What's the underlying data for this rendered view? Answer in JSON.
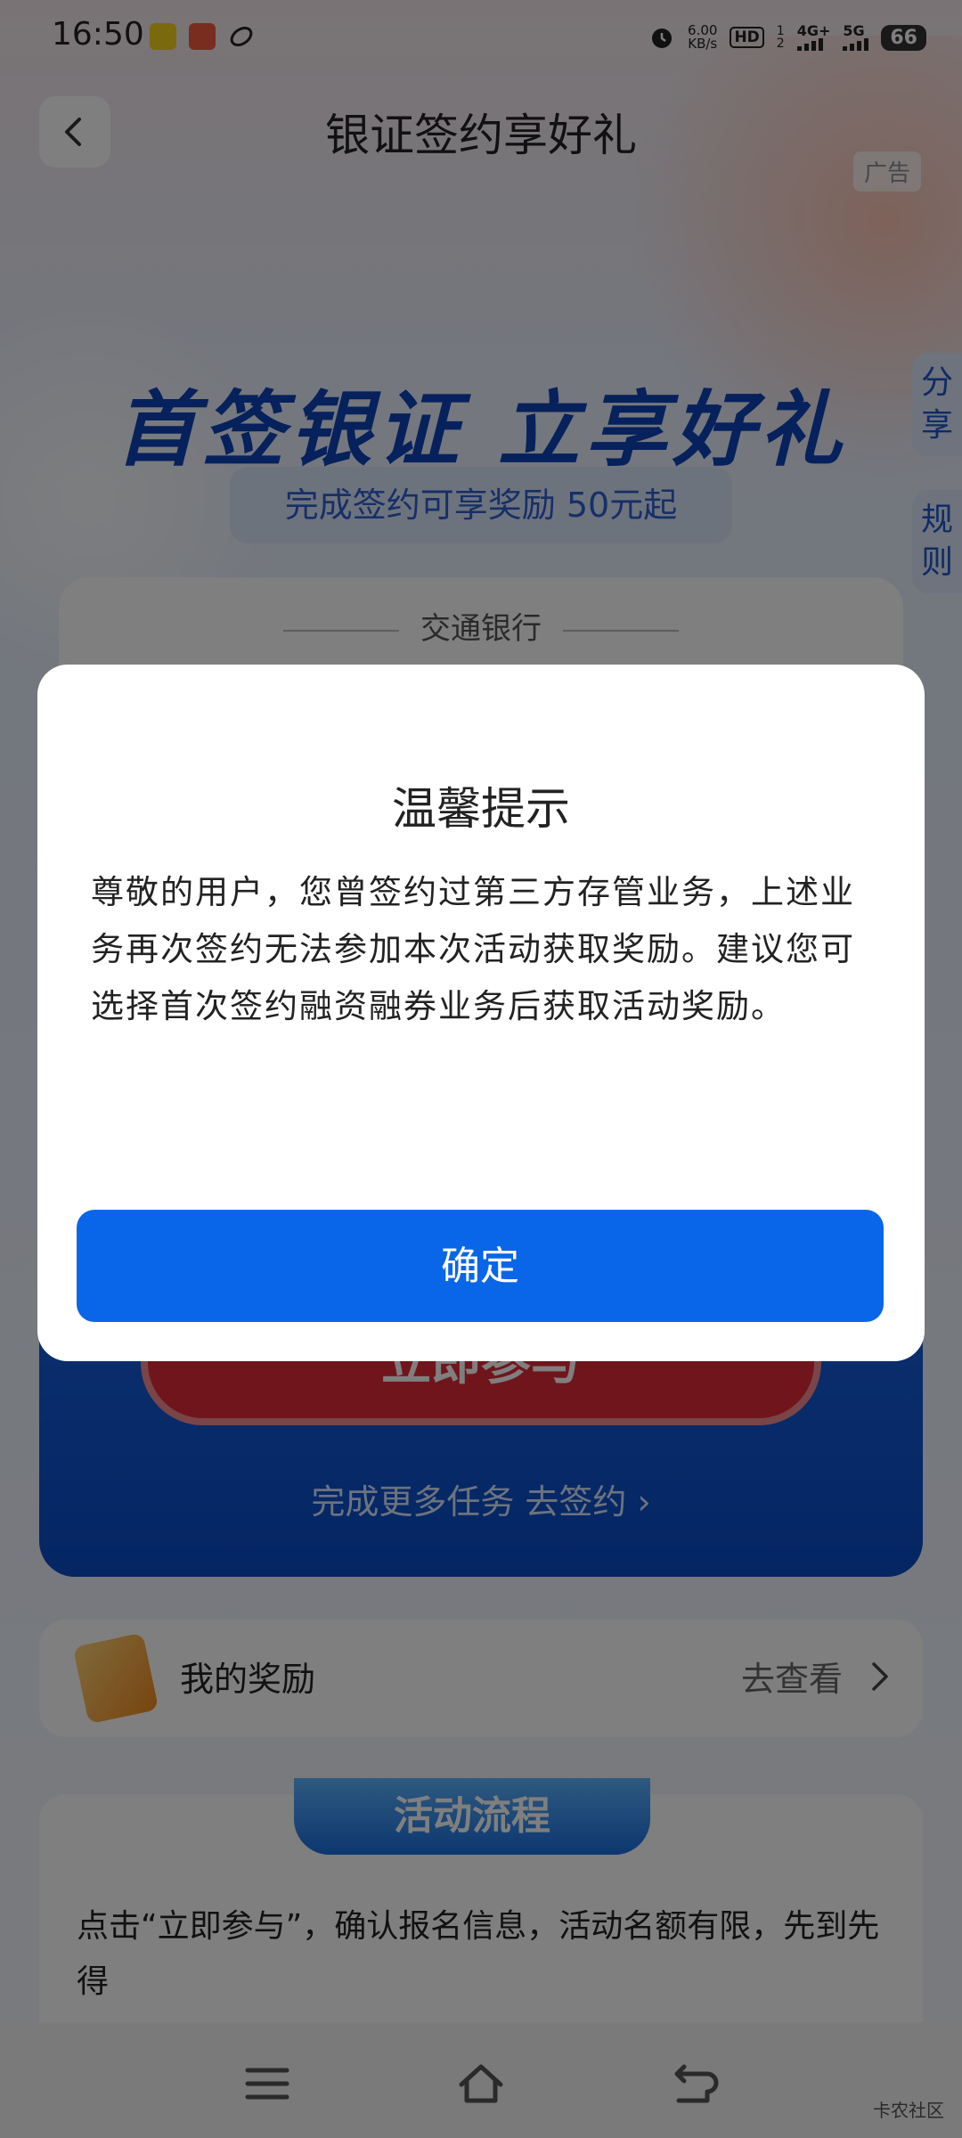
{
  "status_bar": {
    "time": "16:50",
    "net_speed_value": "6.00",
    "net_speed_unit": "KB/s",
    "hd_label": "HD",
    "sim_1": "1",
    "sim_2": "2",
    "network_4g": "4G+",
    "network_5g": "5G",
    "battery": "66"
  },
  "header": {
    "title": "银证签约享好礼",
    "ad_label": "广告"
  },
  "hero": {
    "headline": "首签银证 立享好礼",
    "subtitle": "完成签约可享奖励 50元起"
  },
  "side_tabs": {
    "share": "分享",
    "rules": "规则"
  },
  "bank_card": {
    "bank_name": "交通银行",
    "join_label": "立即参与",
    "more_tasks": "完成更多任务 去签约 ›"
  },
  "rewards": {
    "label": "我的奖励",
    "link": "去查看"
  },
  "flow": {
    "title": "活动流程",
    "text": "点击“立即参与”，确认报名信息，活动名额有限，先到先得"
  },
  "dialog": {
    "title": "温馨提示",
    "message": "尊敬的用户，您曾签约过第三方存管业务，上述业务再次签约无法参加本次活动获取奖励。建议您可选择首次签约融资融券业务后获取活动奖励。",
    "confirm": "确定"
  },
  "watermark": "卡农社区",
  "colors": {
    "primary_blue": "#0a66e8",
    "headline_blue": "#0c43b8",
    "join_red": "#e32b3a"
  }
}
